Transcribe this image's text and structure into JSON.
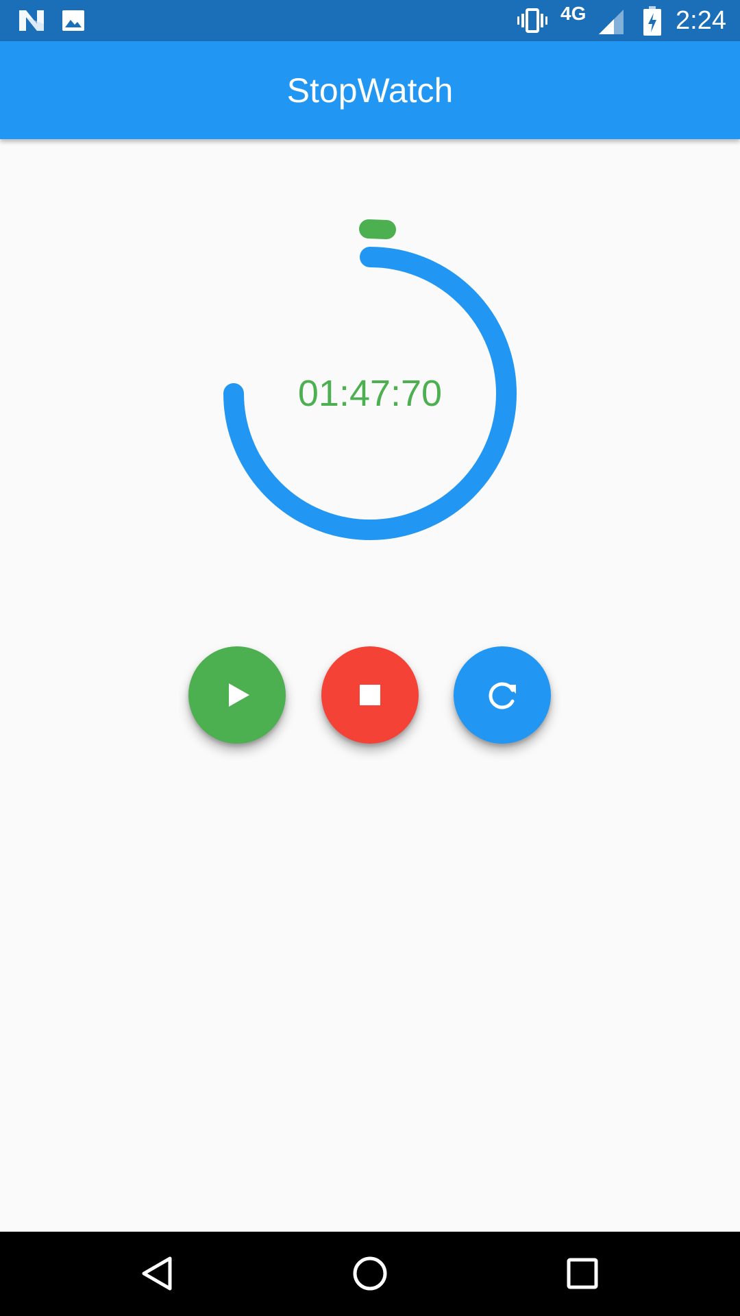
{
  "status_bar": {
    "time": "2:24",
    "network": "4G",
    "icons": [
      "n-logo-icon",
      "image-icon",
      "vibrate-icon",
      "signal-icon",
      "battery-charging-icon"
    ]
  },
  "app_bar": {
    "title": "StopWatch",
    "color": "#2196f3"
  },
  "timer": {
    "display": "01:47:70",
    "text_color": "#4caf50",
    "ring_color": "#2196f3",
    "indicator_color": "#4caf50",
    "progress": 0.75
  },
  "controls": {
    "start": {
      "icon": "play-icon",
      "color": "#4caf50"
    },
    "stop": {
      "icon": "stop-icon",
      "color": "#f44336"
    },
    "reset": {
      "icon": "refresh-icon",
      "color": "#2196f3"
    }
  },
  "nav_bar": {
    "icons": [
      "back-icon",
      "home-icon",
      "recents-icon"
    ]
  }
}
